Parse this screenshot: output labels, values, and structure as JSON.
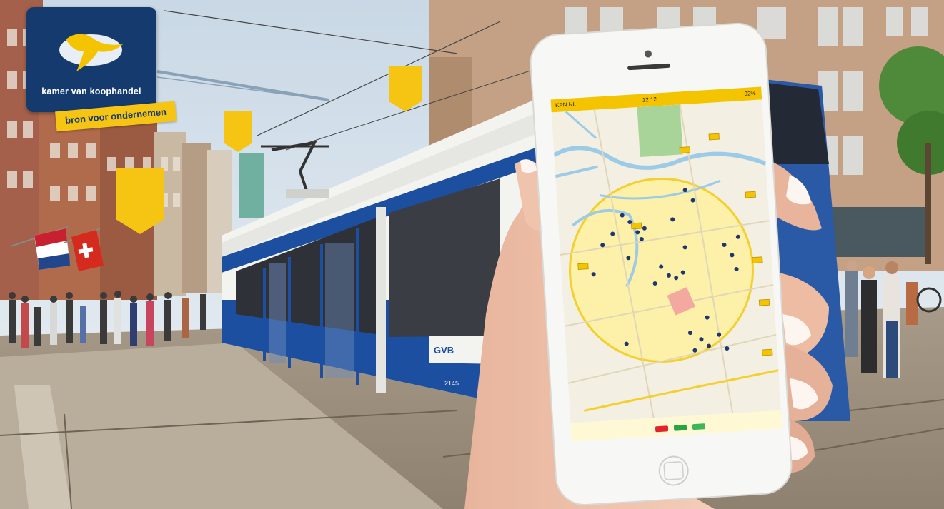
{
  "ad": {
    "logo_text": "kamer van koophandel",
    "tagline": "bron voor ondernemen"
  },
  "tram": {
    "operator_logo": "GVB",
    "number": "2145"
  },
  "phone": {
    "carrier": "KPN NL",
    "time": "12:12",
    "battery": "92%",
    "footer_buttons": [
      {
        "name": "red-map-button",
        "color": "#e0242a"
      },
      {
        "name": "green-map-button",
        "color": "#2aa345"
      },
      {
        "name": "green-map-button-2",
        "color": "#3cb65a"
      }
    ]
  },
  "colors": {
    "brand_blue": "#143a6e",
    "brand_yellow": "#f6c514",
    "tram_blue": "#1c4fa0"
  }
}
